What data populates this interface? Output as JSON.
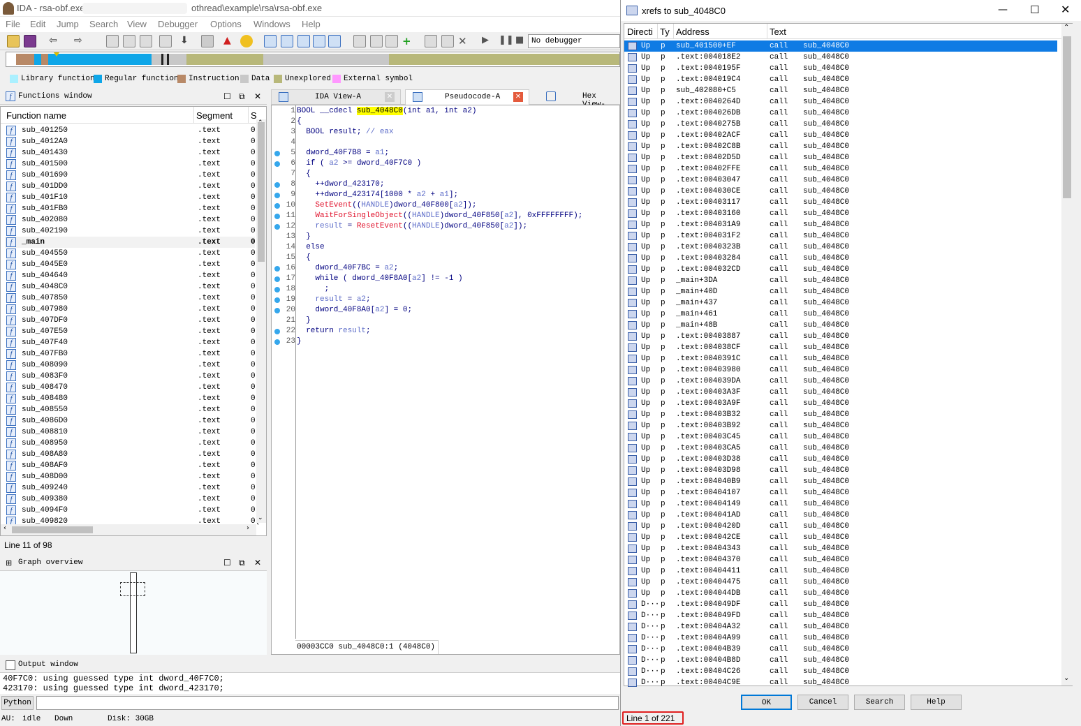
{
  "app_title": "IDA - rsa-obf.exe",
  "app_title_path": "othread\\example\\rsa\\rsa-obf.exe",
  "menu": [
    "File",
    "Edit",
    "Jump",
    "Search",
    "View",
    "Debugger",
    "Options",
    "Windows",
    "Help"
  ],
  "debugger_select": "No debugger",
  "legend": [
    {
      "label": "Library function",
      "color": "#aaf0ff"
    },
    {
      "label": "Regular function",
      "color": "#0ea6e8"
    },
    {
      "label": "Instruction",
      "color": "#b88967"
    },
    {
      "label": "Data",
      "color": "#c8c8c8"
    },
    {
      "label": "Unexplored",
      "color": "#b8b87a"
    },
    {
      "label": "External symbol",
      "color": "#ff98ff"
    }
  ],
  "functions_window": {
    "title": "Functions window",
    "col_name": "Function name",
    "col_segment": "Segment",
    "col_s": "S",
    "rows": [
      {
        "name": "sub_401250",
        "seg": ".text",
        "s": "0("
      },
      {
        "name": "sub_4012A0",
        "seg": ".text",
        "s": "0("
      },
      {
        "name": "sub_401430",
        "seg": ".text",
        "s": "0("
      },
      {
        "name": "sub_401500",
        "seg": ".text",
        "s": "0("
      },
      {
        "name": "sub_401690",
        "seg": ".text",
        "s": "0("
      },
      {
        "name": "sub_401DD0",
        "seg": ".text",
        "s": "0("
      },
      {
        "name": "sub_401F10",
        "seg": ".text",
        "s": "0("
      },
      {
        "name": "sub_401FB0",
        "seg": ".text",
        "s": "0("
      },
      {
        "name": "sub_402080",
        "seg": ".text",
        "s": "0("
      },
      {
        "name": "sub_402190",
        "seg": ".text",
        "s": "0("
      },
      {
        "name": "_main",
        "seg": ".text",
        "s": "0"
      },
      {
        "name": "sub_404550",
        "seg": ".text",
        "s": "0("
      },
      {
        "name": "sub_4045E0",
        "seg": ".text",
        "s": "0("
      },
      {
        "name": "sub_404640",
        "seg": ".text",
        "s": "0("
      },
      {
        "name": "sub_4048C0",
        "seg": ".text",
        "s": "0("
      },
      {
        "name": "sub_407850",
        "seg": ".text",
        "s": "0("
      },
      {
        "name": "sub_407980",
        "seg": ".text",
        "s": "0("
      },
      {
        "name": "sub_407DF0",
        "seg": ".text",
        "s": "0("
      },
      {
        "name": "sub_407E50",
        "seg": ".text",
        "s": "0("
      },
      {
        "name": "sub_407F40",
        "seg": ".text",
        "s": "0("
      },
      {
        "name": "sub_407FB0",
        "seg": ".text",
        "s": "0("
      },
      {
        "name": "sub_408090",
        "seg": ".text",
        "s": "0("
      },
      {
        "name": "sub_4083F0",
        "seg": ".text",
        "s": "0("
      },
      {
        "name": "sub_408470",
        "seg": ".text",
        "s": "0("
      },
      {
        "name": "sub_408480",
        "seg": ".text",
        "s": "0("
      },
      {
        "name": "sub_408550",
        "seg": ".text",
        "s": "0("
      },
      {
        "name": "sub_4086D0",
        "seg": ".text",
        "s": "0("
      },
      {
        "name": "sub_408810",
        "seg": ".text",
        "s": "0("
      },
      {
        "name": "sub_408950",
        "seg": ".text",
        "s": "0("
      },
      {
        "name": "sub_408A80",
        "seg": ".text",
        "s": "0("
      },
      {
        "name": "sub_408AF0",
        "seg": ".text",
        "s": "0("
      },
      {
        "name": "sub_408D00",
        "seg": ".text",
        "s": "0("
      },
      {
        "name": "sub_409240",
        "seg": ".text",
        "s": "0("
      },
      {
        "name": "sub_409380",
        "seg": ".text",
        "s": "0("
      },
      {
        "name": "sub_4094F0",
        "seg": ".text",
        "s": "0("
      },
      {
        "name": "sub_409820",
        "seg": ".text",
        "s": "0("
      }
    ],
    "status": "Line 11 of 98"
  },
  "graph_overview": {
    "title": "Graph overview"
  },
  "tabs": {
    "ida_view": "IDA View-A",
    "pseudocode": "Pseudocode-A",
    "hex_view": "Hex View-"
  },
  "pseudocode": {
    "lines": [
      {
        "n": "1",
        "dot": false,
        "parts": [
          [
            "BOOL __cdecl ",
            ""
          ],
          [
            "sub_4048C0",
            "hl"
          ],
          [
            "(int a1, int a2)",
            ""
          ]
        ]
      },
      {
        "n": "2",
        "dot": false,
        "parts": [
          [
            "{",
            ""
          ]
        ]
      },
      {
        "n": "3",
        "dot": false,
        "parts": [
          [
            "  BOOL result; ",
            ""
          ],
          [
            "// eax",
            "vr"
          ]
        ]
      },
      {
        "n": "4",
        "dot": false,
        "parts": []
      },
      {
        "n": "5",
        "dot": true,
        "parts": [
          [
            "  dword_40F7B8",
            "gl"
          ],
          [
            " = ",
            ""
          ],
          [
            "a1",
            "vr"
          ],
          [
            ";",
            ""
          ]
        ]
      },
      {
        "n": "6",
        "dot": true,
        "parts": [
          [
            "  if ( ",
            ""
          ],
          [
            "a2",
            "vr"
          ],
          [
            " >= ",
            ""
          ],
          [
            "dword_40F7C0",
            "gl"
          ],
          [
            " )",
            ""
          ]
        ]
      },
      {
        "n": "7",
        "dot": false,
        "parts": [
          [
            "  {",
            ""
          ]
        ]
      },
      {
        "n": "8",
        "dot": true,
        "parts": [
          [
            "    ++",
            ""
          ],
          [
            "dword_423170",
            "gl"
          ],
          [
            ";",
            ""
          ]
        ]
      },
      {
        "n": "9",
        "dot": true,
        "parts": [
          [
            "    ++",
            ""
          ],
          [
            "dword_423174",
            "gl"
          ],
          [
            "[1000 * ",
            ""
          ],
          [
            "a2",
            "vr"
          ],
          [
            " + ",
            ""
          ],
          [
            "a1",
            "vr"
          ],
          [
            "];",
            ""
          ]
        ]
      },
      {
        "n": "10",
        "dot": true,
        "parts": [
          [
            "    ",
            ""
          ],
          [
            "SetEvent",
            "fnc"
          ],
          [
            "((",
            ""
          ],
          [
            "HANDLE",
            "vr"
          ],
          [
            ")",
            ""
          ],
          [
            "dword_40F800",
            "gl"
          ],
          [
            "[",
            ""
          ],
          [
            "a2",
            "vr"
          ],
          [
            "]);",
            ""
          ]
        ]
      },
      {
        "n": "11",
        "dot": true,
        "parts": [
          [
            "    ",
            ""
          ],
          [
            "WaitForSingleObject",
            "fnc"
          ],
          [
            "((",
            ""
          ],
          [
            "HANDLE",
            "vr"
          ],
          [
            ")",
            ""
          ],
          [
            "dword_40F850",
            "gl"
          ],
          [
            "[",
            ""
          ],
          [
            "a2",
            "vr"
          ],
          [
            "], 0xFFFFFFFF);",
            ""
          ]
        ]
      },
      {
        "n": "12",
        "dot": true,
        "parts": [
          [
            "    ",
            ""
          ],
          [
            "result",
            "vr"
          ],
          [
            " = ",
            ""
          ],
          [
            "ResetEvent",
            "fnc"
          ],
          [
            "((",
            ""
          ],
          [
            "HANDLE",
            "vr"
          ],
          [
            ")",
            ""
          ],
          [
            "dword_40F850",
            "gl"
          ],
          [
            "[",
            ""
          ],
          [
            "a2",
            "vr"
          ],
          [
            "]);",
            ""
          ]
        ]
      },
      {
        "n": "13",
        "dot": false,
        "parts": [
          [
            "  }",
            ""
          ]
        ]
      },
      {
        "n": "14",
        "dot": false,
        "parts": [
          [
            "  else",
            ""
          ]
        ]
      },
      {
        "n": "15",
        "dot": false,
        "parts": [
          [
            "  {",
            ""
          ]
        ]
      },
      {
        "n": "16",
        "dot": true,
        "parts": [
          [
            "    ",
            ""
          ],
          [
            "dword_40F7BC",
            "gl"
          ],
          [
            " = ",
            ""
          ],
          [
            "a2",
            "vr"
          ],
          [
            ";",
            ""
          ]
        ]
      },
      {
        "n": "17",
        "dot": true,
        "parts": [
          [
            "    while ( ",
            ""
          ],
          [
            "dword_40F8A0",
            "gl"
          ],
          [
            "[",
            ""
          ],
          [
            "a2",
            "vr"
          ],
          [
            "] != -1 )",
            ""
          ]
        ]
      },
      {
        "n": "18",
        "dot": true,
        "parts": [
          [
            "      ;",
            ""
          ]
        ]
      },
      {
        "n": "19",
        "dot": true,
        "parts": [
          [
            "    ",
            ""
          ],
          [
            "result",
            "vr"
          ],
          [
            " = ",
            ""
          ],
          [
            "a2",
            "vr"
          ],
          [
            ";",
            ""
          ]
        ]
      },
      {
        "n": "20",
        "dot": true,
        "parts": [
          [
            "    ",
            ""
          ],
          [
            "dword_40F8A0",
            "gl"
          ],
          [
            "[",
            ""
          ],
          [
            "a2",
            "vr"
          ],
          [
            "] = 0;",
            ""
          ]
        ]
      },
      {
        "n": "21",
        "dot": false,
        "parts": [
          [
            "  }",
            ""
          ]
        ]
      },
      {
        "n": "22",
        "dot": true,
        "parts": [
          [
            "  return ",
            ""
          ],
          [
            "result",
            "vr"
          ],
          [
            ";",
            ""
          ]
        ]
      },
      {
        "n": "23",
        "dot": true,
        "parts": [
          [
            "}",
            ""
          ]
        ]
      }
    ],
    "status": "00003CC0 sub_4048C0:1 (4048C0)"
  },
  "output_window": {
    "title": "Output window",
    "lines": [
      "40F7C0: using guessed type int dword_40F7C0;",
      "423170: using guessed type int dword_423170;"
    ],
    "python_label": "Python"
  },
  "statusbar": {
    "au": "AU:",
    "state": "idle",
    "dir": "Down",
    "disk": "Disk: 30GB"
  },
  "xrefs": {
    "title": "xrefs to sub_4048C0",
    "col_direction": "Directi",
    "col_type": "Ty",
    "col_address": "Address",
    "col_text": "Text",
    "rows": [
      [
        "Up",
        "p",
        "sub_401500+EF",
        "call",
        "sub_4048C0"
      ],
      [
        "Up",
        "p",
        ".text:004018E2",
        "call",
        "sub_4048C0"
      ],
      [
        "Up",
        "p",
        ".text:0040195F",
        "call",
        "sub_4048C0"
      ],
      [
        "Up",
        "p",
        ".text:004019C4",
        "call",
        "sub_4048C0"
      ],
      [
        "Up",
        "p",
        "sub_402080+C5",
        "call",
        "sub_4048C0"
      ],
      [
        "Up",
        "p",
        ".text:0040264D",
        "call",
        "sub_4048C0"
      ],
      [
        "Up",
        "p",
        ".text:004026DB",
        "call",
        "sub_4048C0"
      ],
      [
        "Up",
        "p",
        ".text:0040275B",
        "call",
        "sub_4048C0"
      ],
      [
        "Up",
        "p",
        ".text:00402ACF",
        "call",
        "sub_4048C0"
      ],
      [
        "Up",
        "p",
        ".text:00402C8B",
        "call",
        "sub_4048C0"
      ],
      [
        "Up",
        "p",
        ".text:00402D5D",
        "call",
        "sub_4048C0"
      ],
      [
        "Up",
        "p",
        ".text:00402FFE",
        "call",
        "sub_4048C0"
      ],
      [
        "Up",
        "p",
        ".text:00403047",
        "call",
        "sub_4048C0"
      ],
      [
        "Up",
        "p",
        ".text:004030CE",
        "call",
        "sub_4048C0"
      ],
      [
        "Up",
        "p",
        ".text:00403117",
        "call",
        "sub_4048C0"
      ],
      [
        "Up",
        "p",
        ".text:00403160",
        "call",
        "sub_4048C0"
      ],
      [
        "Up",
        "p",
        ".text:004031A9",
        "call",
        "sub_4048C0"
      ],
      [
        "Up",
        "p",
        ".text:004031F2",
        "call",
        "sub_4048C0"
      ],
      [
        "Up",
        "p",
        ".text:0040323B",
        "call",
        "sub_4048C0"
      ],
      [
        "Up",
        "p",
        ".text:00403284",
        "call",
        "sub_4048C0"
      ],
      [
        "Up",
        "p",
        ".text:004032CD",
        "call",
        "sub_4048C0"
      ],
      [
        "Up",
        "p",
        "_main+3DA",
        "call",
        "sub_4048C0"
      ],
      [
        "Up",
        "p",
        "_main+40D",
        "call",
        "sub_4048C0"
      ],
      [
        "Up",
        "p",
        "_main+437",
        "call",
        "sub_4048C0"
      ],
      [
        "Up",
        "p",
        "_main+461",
        "call",
        "sub_4048C0"
      ],
      [
        "Up",
        "p",
        "_main+48B",
        "call",
        "sub_4048C0"
      ],
      [
        "Up",
        "p",
        ".text:00403887",
        "call",
        "sub_4048C0"
      ],
      [
        "Up",
        "p",
        ".text:004038CF",
        "call",
        "sub_4048C0"
      ],
      [
        "Up",
        "p",
        ".text:0040391C",
        "call",
        "sub_4048C0"
      ],
      [
        "Up",
        "p",
        ".text:00403980",
        "call",
        "sub_4048C0"
      ],
      [
        "Up",
        "p",
        ".text:004039DA",
        "call",
        "sub_4048C0"
      ],
      [
        "Up",
        "p",
        ".text:00403A3F",
        "call",
        "sub_4048C0"
      ],
      [
        "Up",
        "p",
        ".text:00403A9F",
        "call",
        "sub_4048C0"
      ],
      [
        "Up",
        "p",
        ".text:00403B32",
        "call",
        "sub_4048C0"
      ],
      [
        "Up",
        "p",
        ".text:00403B92",
        "call",
        "sub_4048C0"
      ],
      [
        "Up",
        "p",
        ".text:00403C45",
        "call",
        "sub_4048C0"
      ],
      [
        "Up",
        "p",
        ".text:00403CA5",
        "call",
        "sub_4048C0"
      ],
      [
        "Up",
        "p",
        ".text:00403D38",
        "call",
        "sub_4048C0"
      ],
      [
        "Up",
        "p",
        ".text:00403D98",
        "call",
        "sub_4048C0"
      ],
      [
        "Up",
        "p",
        ".text:004040B9",
        "call",
        "sub_4048C0"
      ],
      [
        "Up",
        "p",
        ".text:00404107",
        "call",
        "sub_4048C0"
      ],
      [
        "Up",
        "p",
        ".text:00404149",
        "call",
        "sub_4048C0"
      ],
      [
        "Up",
        "p",
        ".text:004041AD",
        "call",
        "sub_4048C0"
      ],
      [
        "Up",
        "p",
        ".text:0040420D",
        "call",
        "sub_4048C0"
      ],
      [
        "Up",
        "p",
        ".text:004042CE",
        "call",
        "sub_4048C0"
      ],
      [
        "Up",
        "p",
        ".text:00404343",
        "call",
        "sub_4048C0"
      ],
      [
        "Up",
        "p",
        ".text:00404370",
        "call",
        "sub_4048C0"
      ],
      [
        "Up",
        "p",
        ".text:00404411",
        "call",
        "sub_4048C0"
      ],
      [
        "Up",
        "p",
        ".text:00404475",
        "call",
        "sub_4048C0"
      ],
      [
        "Up",
        "p",
        ".text:004044DB",
        "call",
        "sub_4048C0"
      ],
      [
        "D···",
        "p",
        ".text:004049DF",
        "call",
        "sub_4048C0"
      ],
      [
        "D···",
        "p",
        ".text:004049FD",
        "call",
        "sub_4048C0"
      ],
      [
        "D···",
        "p",
        ".text:00404A32",
        "call",
        "sub_4048C0"
      ],
      [
        "D···",
        "p",
        ".text:00404A99",
        "call",
        "sub_4048C0"
      ],
      [
        "D···",
        "p",
        ".text:00404B39",
        "call",
        "sub_4048C0"
      ],
      [
        "D···",
        "p",
        ".text:00404B8D",
        "call",
        "sub_4048C0"
      ],
      [
        "D···",
        "p",
        ".text:00404C26",
        "call",
        "sub_4048C0"
      ],
      [
        "D···",
        "p",
        ".text:00404C9E",
        "call",
        "sub_4048C0"
      ]
    ],
    "buttons": {
      "ok": "OK",
      "cancel": "Cancel",
      "search": "Search",
      "help": "Help"
    },
    "status": "Line 1 of 221"
  },
  "colors": {
    "selection": "#0f7be4",
    "highlight": "#ffff00",
    "status_outline": "#e02020"
  }
}
